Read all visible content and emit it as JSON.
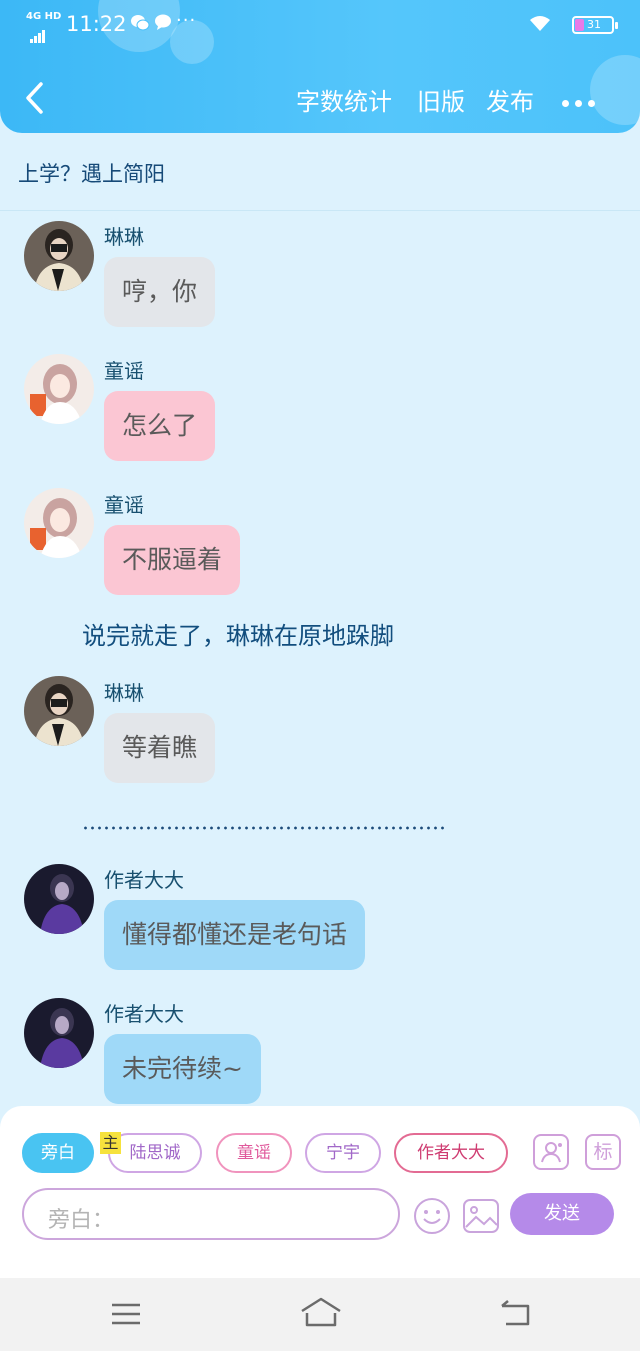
{
  "status_bar": {
    "network": "4G HD",
    "time": "11:22",
    "more_indicator": "···",
    "battery_level": "31"
  },
  "header": {
    "menu": [
      {
        "label": "字数统计"
      },
      {
        "label": "旧版"
      },
      {
        "label": "发布"
      }
    ]
  },
  "story": {
    "title": "上学？遇上简阳"
  },
  "messages": [
    {
      "speaker": "琳琳",
      "text": "哼，你",
      "avatar": "photo-girl-dark-hair"
    },
    {
      "speaker": "童谣",
      "text": "怎么了",
      "avatar": "photo-girl-pink-hair"
    },
    {
      "speaker": "童谣",
      "text": "不服逼着",
      "avatar": "photo-girl-pink-hair"
    },
    {
      "speaker": "琳琳",
      "text": "等着瞧",
      "avatar": "photo-girl-dark-hair"
    },
    {
      "speaker": "作者大大",
      "text": "懂得都懂还是老句话",
      "avatar": "photo-dark-purple"
    },
    {
      "speaker": "作者大大",
      "text": "未完待续~",
      "avatar": "photo-dark-purple"
    }
  ],
  "narration": "说完就走了，琳琳在原地跺脚",
  "separator": "dotted-line",
  "composer": {
    "roles": [
      {
        "label": "旁白",
        "active": true
      },
      {
        "label": "陆思诚",
        "active": false
      },
      {
        "label": "童谣",
        "active": false
      },
      {
        "label": "宁宇",
        "active": false
      },
      {
        "label": "作者大大",
        "active": false
      }
    ],
    "main_tag": "主",
    "tag_button": "标",
    "input_placeholder": "旁白：",
    "send_label": "发送"
  },
  "colors": {
    "header": "#4cc2fa",
    "background": "#ddf2fd",
    "bubble_gray": "#e3e6ea",
    "bubble_pink": "#fbc6d3",
    "bubble_blue": "#9fd9f8",
    "send": "#b58ae9",
    "active_role": "#49c4f2"
  }
}
